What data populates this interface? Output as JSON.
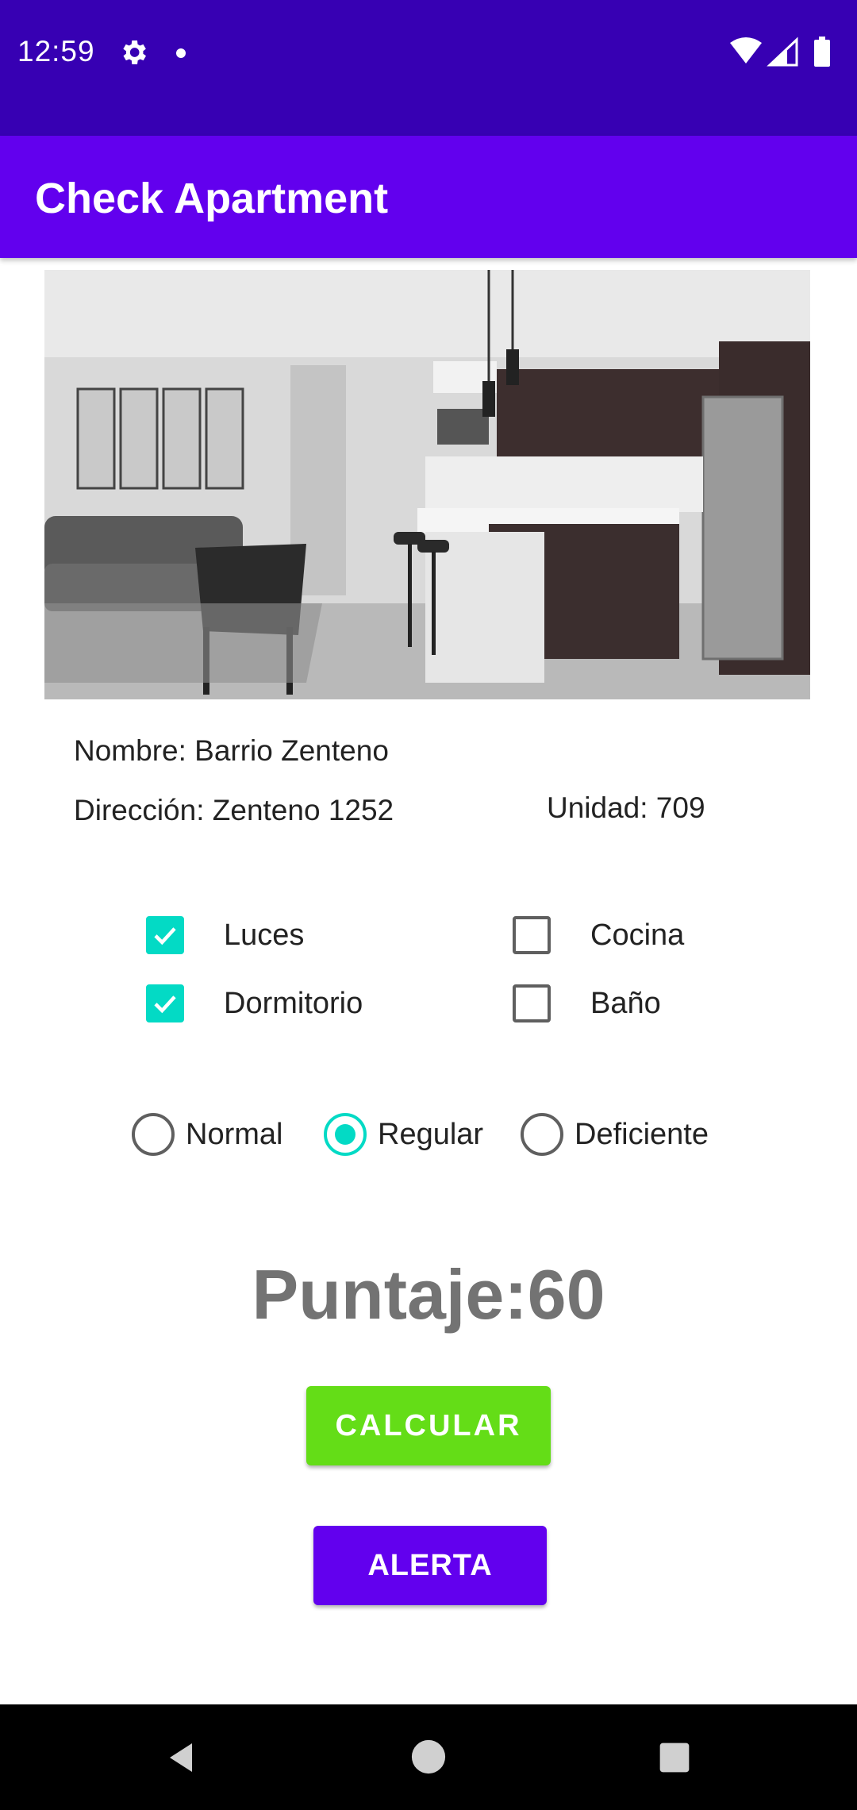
{
  "status_bar": {
    "time": "12:59",
    "icons": [
      "gear-icon",
      "notification-dot-icon",
      "wifi-icon",
      "signal-icon",
      "battery-icon"
    ]
  },
  "app_bar": {
    "title": "Check Apartment",
    "background": "#6200ee"
  },
  "apartment": {
    "image": "apartment-photo",
    "name": "Nombre: Barrio Zenteno",
    "address": "Dirección: Zenteno 1252",
    "unit": "Unidad: 709"
  },
  "checklist": [
    {
      "label": "Luces",
      "checked": true
    },
    {
      "label": "Cocina",
      "checked": false
    },
    {
      "label": "Dormitorio",
      "checked": true
    },
    {
      "label": "Baño",
      "checked": false
    }
  ],
  "condition": {
    "options": [
      "Normal",
      "Regular",
      "Deficiente"
    ],
    "selected": "Regular"
  },
  "score": "Puntaje:60",
  "buttons": {
    "calculate": "CALCULAR",
    "alert": "ALERTA"
  },
  "colors": {
    "status_bar": "#3700b3",
    "accent": "#03dac5",
    "calculate_button": "#64dd17",
    "alert_button": "#6200ee"
  },
  "nav_bar": {
    "icons": [
      "back-icon",
      "home-icon",
      "recents-icon"
    ]
  }
}
